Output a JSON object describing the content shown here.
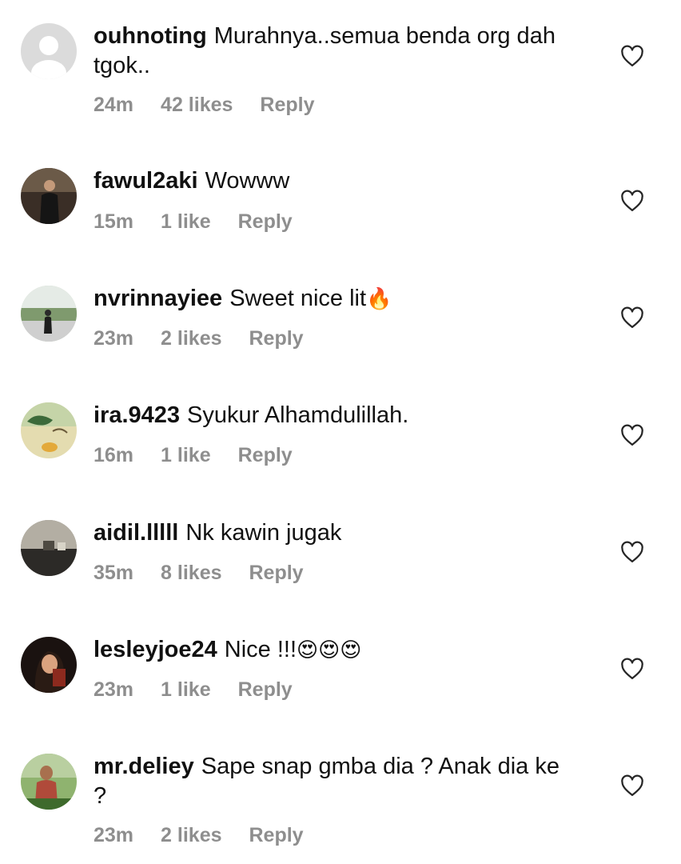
{
  "comments": [
    {
      "username": "ouhnoting",
      "text": "Murahnya..semua benda org dah tgok..",
      "emoji": "",
      "time": "24m",
      "likes": "42 likes",
      "reply": "Reply",
      "avatar": "default-avatar"
    },
    {
      "username": "fawul2aki",
      "text": "Wowww",
      "emoji": "",
      "time": "15m",
      "likes": "1 like",
      "reply": "Reply",
      "avatar": "man-in-suit-photo"
    },
    {
      "username": "nvrinnayiee",
      "text": "Sweet nice lit",
      "emoji": "🔥",
      "time": "23m",
      "likes": "2 likes",
      "reply": "Reply",
      "avatar": "woman-outdoors-photo"
    },
    {
      "username": "ira.9423",
      "text": "Syukur Alhamdulillah.",
      "emoji": "",
      "time": "16m",
      "likes": "1 like",
      "reply": "Reply",
      "avatar": "ramadan-greeting-photo"
    },
    {
      "username": "aidil.lllll",
      "text": "Nk kawin jugak",
      "emoji": "",
      "time": "35m",
      "likes": "8 likes",
      "reply": "Reply",
      "avatar": "room-interior-photo"
    },
    {
      "username": "lesleyjoe24",
      "text": "Nice !!!",
      "emoji": "😍😍😍",
      "time": "23m",
      "likes": "1 like",
      "reply": "Reply",
      "avatar": "woman-portrait-photo"
    },
    {
      "username": "mr.deliey",
      "text": "Sape snap gmba dia ? Anak dia ke ?",
      "emoji": "",
      "time": "23m",
      "likes": "2 likes",
      "reply": "Reply",
      "avatar": "man-outdoors-photo"
    }
  ],
  "colors": {
    "text": "#111111",
    "meta": "#8e8e8e",
    "heart_outline": "#262626"
  },
  "icons": {
    "like": "heart-outline-icon"
  }
}
